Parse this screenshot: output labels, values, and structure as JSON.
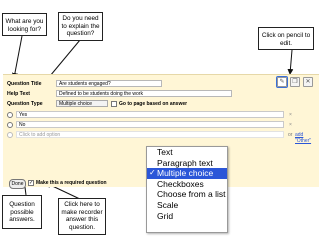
{
  "callouts": {
    "what": "What are you looking for?",
    "explain": "Do you need to explain the question?",
    "pencil": "Click on pencil to edit.",
    "possible": "Question possible answers.",
    "recorder": "Click here to make recorder answer this question."
  },
  "editor": {
    "title_label": "Question Title",
    "title_value": "Are students engaged?",
    "help_label": "Help Text",
    "help_value": "Defined to be students doing the work",
    "type_label": "Question Type",
    "type_value": "Multiple choice",
    "go_to_page_label": "Go to page based on answer",
    "options": [
      "Yes",
      "No"
    ],
    "add_option_placeholder": "Click to add option",
    "add_other_prefix": "or",
    "add_other_link": "add \"Other\"",
    "done_label": "Done",
    "required_label": "Make this a required question"
  },
  "dropdown": {
    "items": [
      "Text",
      "Paragraph text",
      "Multiple choice",
      "Checkboxes",
      "Choose from a list",
      "Scale",
      "Grid"
    ],
    "selected": "Multiple choice"
  },
  "colors": {
    "editor_bg": "#fff6d6",
    "selected_bg": "#2b56d8"
  }
}
